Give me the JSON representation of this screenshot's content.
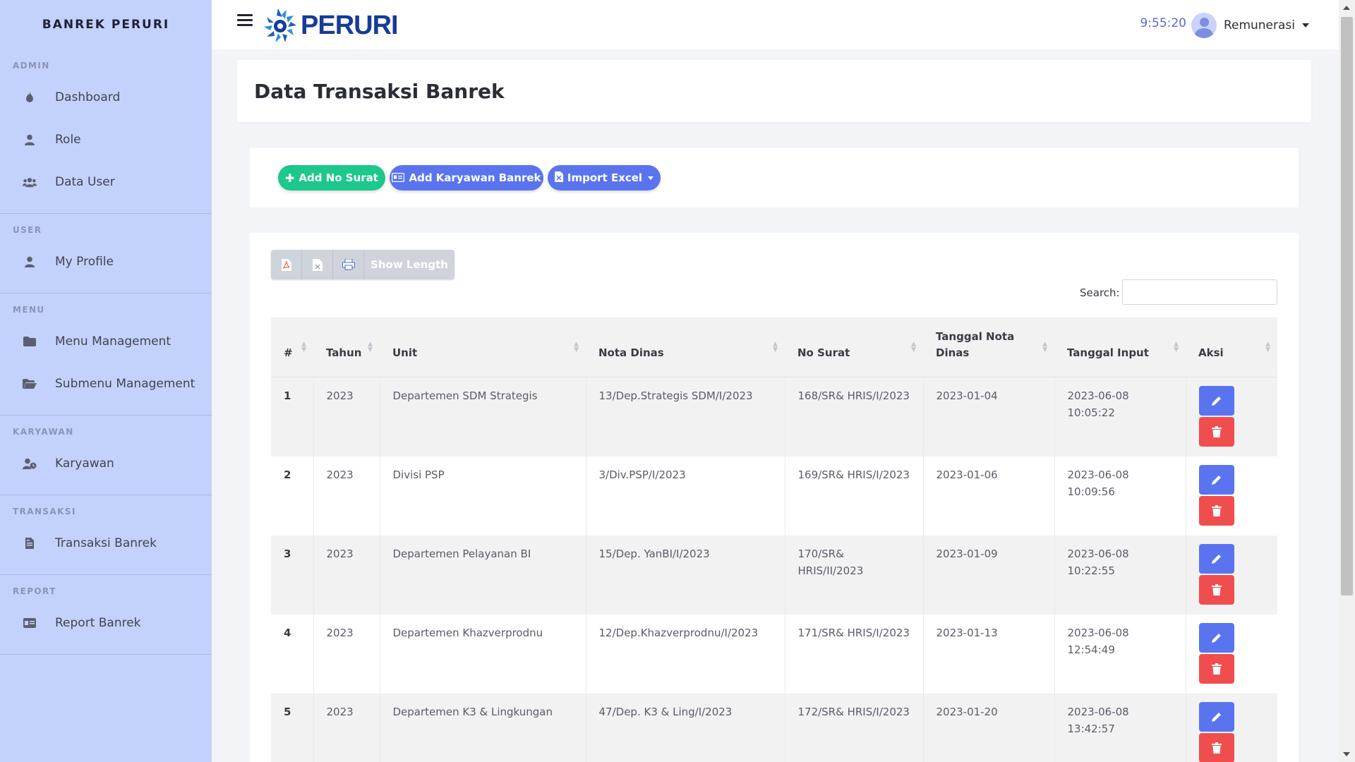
{
  "sidebar": {
    "brand": "BANREK PERURI",
    "sections": [
      {
        "heading": "ADMIN",
        "items": [
          {
            "label": "Dashboard",
            "icon": "fire-icon"
          },
          {
            "label": "Role",
            "icon": "user-icon"
          },
          {
            "label": "Data User",
            "icon": "users-icon"
          }
        ]
      },
      {
        "heading": "USER",
        "items": [
          {
            "label": "My Profile",
            "icon": "user-icon"
          }
        ]
      },
      {
        "heading": "MENU",
        "items": [
          {
            "label": "Menu Management",
            "icon": "folder-icon"
          },
          {
            "label": "Submenu Management",
            "icon": "folder-open-icon"
          }
        ]
      },
      {
        "heading": "KARYAWAN",
        "items": [
          {
            "label": "Karyawan",
            "icon": "user-clock-icon"
          }
        ]
      },
      {
        "heading": "TRANSAKSI",
        "items": [
          {
            "label": "Transaksi Banrek",
            "icon": "file-invoice-icon"
          }
        ]
      },
      {
        "heading": "REPORT",
        "items": [
          {
            "label": "Report Banrek",
            "icon": "id-card-icon"
          }
        ]
      }
    ]
  },
  "topbar": {
    "logo_text": "PERURI",
    "clock": "9:55:20",
    "user_name": "Remunerasi"
  },
  "page": {
    "title": "Data Transaksi Banrek"
  },
  "actions": {
    "add_no_surat": "Add No Surat",
    "add_karyawan": "Add Karyawan Banrek",
    "import_excel": "Import Excel"
  },
  "table": {
    "show_length": "Show Length",
    "search_label": "Search:",
    "search_value": "",
    "headers": {
      "num": "#",
      "tahun": "Tahun",
      "unit": "Unit",
      "nota": "Nota Dinas",
      "surat": "No Surat",
      "tgl_nota_1": "Tanggal Nota",
      "tgl_nota_2": "Dinas",
      "tgl_input": "Tanggal Input",
      "aksi": "Aksi"
    },
    "rows": [
      {
        "num": "1",
        "tahun": "2023",
        "unit": "Departemen SDM Strategis",
        "nota": "13/Dep.Strategis SDM/I/2023",
        "surat": "168/SR& HRIS/I/2023",
        "tgl_nota": "2023-01-04",
        "tgl_input_date": "2023-06-08",
        "tgl_input_time": "10:05:22"
      },
      {
        "num": "2",
        "tahun": "2023",
        "unit": "Divisi PSP",
        "nota": "3/Div.PSP/I/2023",
        "surat": "169/SR& HRIS/I/2023",
        "tgl_nota": "2023-01-06",
        "tgl_input_date": "2023-06-08",
        "tgl_input_time": "10:09:56"
      },
      {
        "num": "3",
        "tahun": "2023",
        "unit": "Departemen Pelayanan BI",
        "nota": "15/Dep. YanBI/I/2023",
        "surat": "170/SR& HRIS/II/2023",
        "tgl_nota": "2023-01-09",
        "tgl_input_date": "2023-06-08",
        "tgl_input_time": "10:22:55"
      },
      {
        "num": "4",
        "tahun": "2023",
        "unit": "Departemen Khazverprodnu",
        "nota": "12/Dep.Khazverprodnu/I/2023",
        "surat": "171/SR& HRIS/I/2023",
        "tgl_nota": "2023-01-13",
        "tgl_input_date": "2023-06-08",
        "tgl_input_time": "12:54:49"
      },
      {
        "num": "5",
        "tahun": "2023",
        "unit": "Departemen K3 & Lingkungan",
        "nota": "47/Dep. K3 & Ling/I/2023",
        "surat": "172/SR& HRIS/I/2023",
        "tgl_nota": "2023-01-20",
        "tgl_input_date": "2023-06-08",
        "tgl_input_time": "13:42:57"
      }
    ]
  },
  "colors": {
    "sidebar_bg": "#c3d2fc",
    "primary": "#5a74f0",
    "success": "#1cc88a",
    "danger": "#f04e4e",
    "logo": "#173c96"
  }
}
